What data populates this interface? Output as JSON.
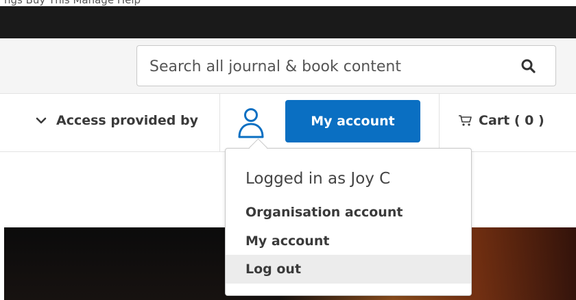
{
  "top_fragment": "ngs    Buy                             This    Manage               Help",
  "search": {
    "placeholder": "Search all journal & book content"
  },
  "nav": {
    "access_label": "Access provided by",
    "account_button": "My account",
    "cart_label": "Cart ( 0 )"
  },
  "account_menu": {
    "heading": "Logged in as Joy C",
    "items": [
      {
        "label": "Organisation account"
      },
      {
        "label": "My account"
      },
      {
        "label": "Log out"
      }
    ]
  },
  "colors": {
    "brand_blue": "#0a6fc2",
    "header_dark": "#1a1a1a",
    "hover_gray": "#ececec"
  }
}
